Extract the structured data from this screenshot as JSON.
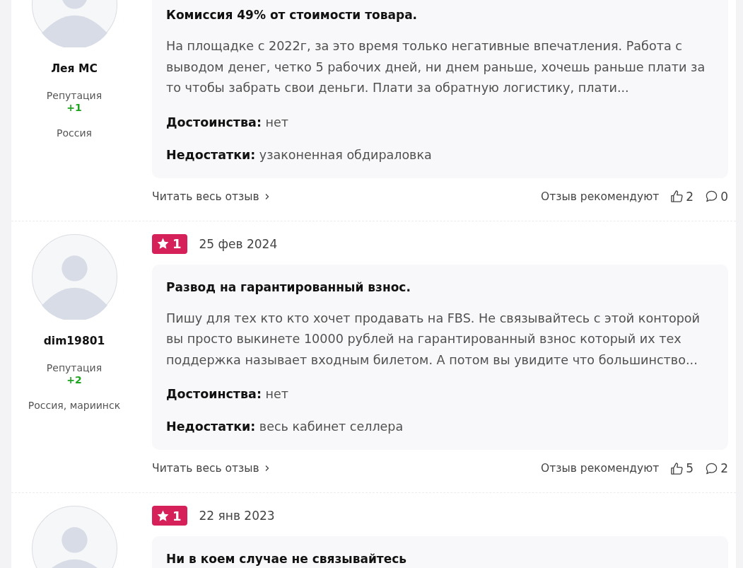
{
  "reviews": [
    {
      "author": "Лея МС",
      "reputation_label": "Репутация",
      "reputation": "+1",
      "location": "Россия",
      "title": "Комиссия 49% от стоимости товара.",
      "body": "На площадке с 2022г, за это время только негативные впечатления. Работа с выводом денег, четко 5 рабочих дней, ни днем раньше, хочешь раньше плати за то чтобы забрать свои деньги. Плати за обратную логистику, плати...",
      "pros_label": "Достоинства:",
      "pros": "нет",
      "cons_label": "Недостатки:",
      "cons": "узаконенная обдираловка",
      "read_more": "Читать весь отзыв",
      "recommend_label": "Отзыв рекомендуют",
      "likes": "2",
      "comments": "0"
    },
    {
      "rating": "1",
      "date": "25 фев 2024",
      "author": "dim19801",
      "reputation_label": "Репутация",
      "reputation": "+2",
      "location": "Россия, мариинск",
      "title": "Развод на гарантированный взнос.",
      "body": "Пишу для тех кто кто хочет продавать на FBS. Не связывайтесь с этой конторой вы просто выкинете 10000 рублей на гарантированный взнос который их тех поддержка называет входным билетом. А потом вы увидите что большинство...",
      "pros_label": "Достоинства:",
      "pros": "нет",
      "cons_label": "Недостатки:",
      "cons": "весь кабинет селлера",
      "read_more": "Читать весь отзыв",
      "recommend_label": "Отзыв рекомендуют",
      "likes": "5",
      "comments": "2"
    },
    {
      "rating": "1",
      "date": "22 янв 2023",
      "title": "Ни в коем случае не связывайтесь"
    }
  ]
}
